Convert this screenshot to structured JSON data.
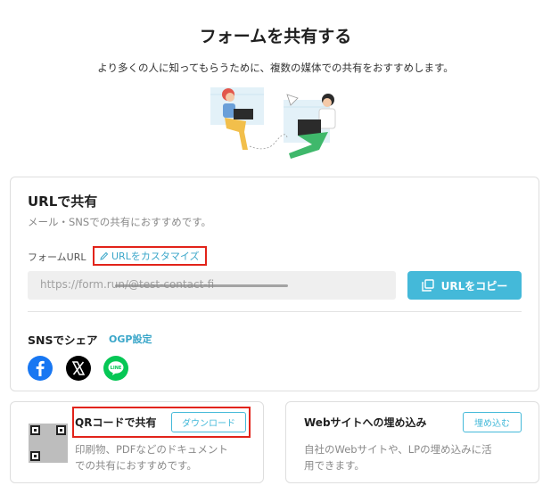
{
  "header": {
    "title": "フォームを共有する",
    "subtitle": "より多くの人に知ってもらうために、複数の媒体での共有をおすすめします。"
  },
  "url_section": {
    "title": "URLで共有",
    "description": "メール・SNSでの共有におすすめです。",
    "form_url_label": "フォームURL",
    "customize_link": "URLをカスタマイズ",
    "url_value": "https://form.run/@test-contact-fi",
    "copy_button": "URLをコピー"
  },
  "sns_section": {
    "title": "SNSでシェア",
    "ogp_link": "OGP設定",
    "icons": [
      "facebook-icon",
      "x-icon",
      "line-icon"
    ],
    "line_icon_text": "LINE"
  },
  "qr_section": {
    "title": "QRコードで共有",
    "download_button": "ダウンロード",
    "description_line1": "印刷物、PDFなどのドキュメント",
    "description_line2": "での共有におすすめです。"
  },
  "web_section": {
    "title": "Webサイトへの埋め込み",
    "embed_button": "埋め込む",
    "description_line1": "自社のWebサイトや、LPの埋め込みに活",
    "description_line2": "用できます。"
  },
  "colors": {
    "accent": "#44b9d9",
    "highlight": "#e2231a",
    "facebook": "#1877f2",
    "x": "#000000",
    "line": "#06c755"
  }
}
